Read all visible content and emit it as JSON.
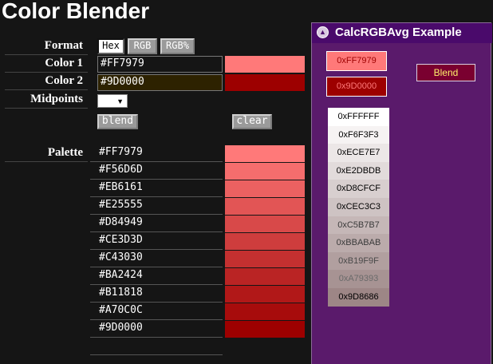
{
  "app": {
    "title": "Color Blender"
  },
  "form": {
    "format_label": "Format",
    "color1_label": "Color 1",
    "color2_label": "Color 2",
    "midpoints_label": "Midpoints",
    "palette_label": "Palette",
    "formats": [
      "Hex",
      "RGB",
      "RGB%"
    ],
    "active_format": "Hex",
    "color1_value": "#FF7979",
    "color2_value": "#9D0000",
    "midpoints_value": "",
    "blend_label": "blend",
    "clear_label": "clear"
  },
  "palette": [
    {
      "hex": "#FF7979",
      "color": "#FF7979"
    },
    {
      "hex": "#F56D6D",
      "color": "#F56D6D"
    },
    {
      "hex": "#EB6161",
      "color": "#EB6161"
    },
    {
      "hex": "#E25555",
      "color": "#E25555"
    },
    {
      "hex": "#D84949",
      "color": "#D84949"
    },
    {
      "hex": "#CE3D3D",
      "color": "#CE3D3D"
    },
    {
      "hex": "#C43030",
      "color": "#C43030"
    },
    {
      "hex": "#BA2424",
      "color": "#BA2424"
    },
    {
      "hex": "#B11818",
      "color": "#B11818"
    },
    {
      "hex": "#A70C0C",
      "color": "#A70C0C"
    },
    {
      "hex": "#9D0000",
      "color": "#9D0000"
    }
  ],
  "panel": {
    "title": "CalcRGBAvg Example",
    "input1": {
      "value": "0xFF7979",
      "bg": "#FF7979",
      "fg": "#9D0000"
    },
    "input2": {
      "value": "0x9D0000",
      "bg": "#9D0000",
      "fg": "#FF7979"
    },
    "blend_label": "Blend",
    "results": [
      {
        "value": "0xFFFFFF",
        "bg": "#FFFFFF",
        "fg": "#000000"
      },
      {
        "value": "0xF6F3F3",
        "bg": "#F6F3F3",
        "fg": "#000000"
      },
      {
        "value": "0xECE7E7",
        "bg": "#ECE7E7",
        "fg": "#000000"
      },
      {
        "value": "0xE2DBDB",
        "bg": "#E2DBDB",
        "fg": "#000000"
      },
      {
        "value": "0xD8CFCF",
        "bg": "#D8CFCF",
        "fg": "#000000"
      },
      {
        "value": "0xCEC3C3",
        "bg": "#CEC3C3",
        "fg": "#000000"
      },
      {
        "value": "0xC5B7B7",
        "bg": "#C5B7B7",
        "fg": "#3a3a3a"
      },
      {
        "value": "0xBBABAB",
        "bg": "#BBABAB",
        "fg": "#3a3a3a"
      },
      {
        "value": "0xB19F9F",
        "bg": "#B19F9F",
        "fg": "#4a4a4a"
      },
      {
        "value": "0xA79393",
        "bg": "#A79393",
        "fg": "#6a6a6a"
      },
      {
        "value": "0x9D8686",
        "bg": "#9D8686",
        "fg": "#000000"
      }
    ]
  },
  "colors": {
    "page_bg": "#151515",
    "panel_bg": "#5a1a6b",
    "panel_header": "#4a0a6b",
    "input1_box_bg": "#151515",
    "input2_box_bg": "#2d2200"
  },
  "icons": {
    "panel_collapse": "chevron-up-circle-icon",
    "midpoints_select": "chevron-down-icon"
  }
}
